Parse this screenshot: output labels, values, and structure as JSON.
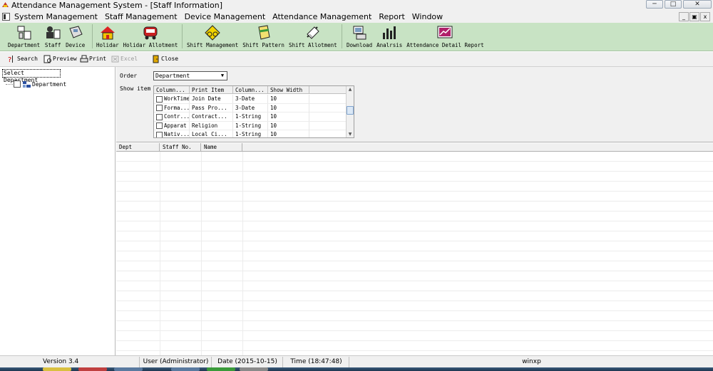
{
  "window": {
    "title": "Attendance Management System - [Staff Information]",
    "min_glyph": "─",
    "max_glyph": "□",
    "close_glyph": "✕"
  },
  "menubar": {
    "items": [
      "System Management",
      "Staff Management",
      "Device Management",
      "Attendance Management",
      "Report",
      "Window"
    ],
    "mdi_min": "_",
    "mdi_restore": "▣",
    "mdi_close": "x"
  },
  "toolbar": {
    "buttons": [
      {
        "label": "Department",
        "icon": "department-icon"
      },
      {
        "label": "Staff",
        "icon": "staff-icon"
      },
      {
        "label": "Device",
        "icon": "device-icon"
      },
      {
        "label": "Holidar",
        "icon": "holiday-icon"
      },
      {
        "label": "Holidar Allotment",
        "icon": "holiday-allotment-icon"
      },
      {
        "label": "Shift Management",
        "icon": "shift-management-icon"
      },
      {
        "label": "Shift Pattern",
        "icon": "shift-pattern-icon"
      },
      {
        "label": "Shift Allotment",
        "icon": "shift-allotment-icon"
      },
      {
        "label": "Download",
        "icon": "download-icon"
      },
      {
        "label": "Analrsis",
        "icon": "analysis-icon"
      },
      {
        "label": "Attendance Detail Report",
        "icon": "report-icon"
      }
    ],
    "background": "#c8e3c4"
  },
  "subtoolbar": {
    "search": "Search",
    "preview": "Preview",
    "print": "Print",
    "excel": "Excel",
    "close": "Close"
  },
  "leftpane": {
    "select_label": "Select Department",
    "tree_root": "Department"
  },
  "options": {
    "order_label": "Order",
    "order_value": "Department",
    "show_item_label": "Show item",
    "columns": [
      "Column...",
      "Print Item",
      "Column...",
      "Show Width"
    ],
    "rows": [
      {
        "name": "WorkTime",
        "print": "Join Date",
        "type": "3-Date",
        "width": "10"
      },
      {
        "name": "Forma...",
        "print": "Pass Pro...",
        "type": "3-Date",
        "width": "10"
      },
      {
        "name": "Contr...",
        "print": "Contract...",
        "type": "1-String",
        "width": "10"
      },
      {
        "name": "Apparat",
        "print": "Religion",
        "type": "1-String",
        "width": "10"
      },
      {
        "name": "Nativ...",
        "print": "Local Ci...",
        "type": "1-String",
        "width": "10"
      }
    ]
  },
  "maingrid": {
    "columns": [
      "Dept",
      "Staff No.",
      "Name"
    ]
  },
  "statusbar": {
    "version": "Version 3.4",
    "user": "User (Administrator)",
    "date": "Date (2015-10-15)",
    "time": "Time (18:47:48)",
    "machine": "winxp"
  }
}
